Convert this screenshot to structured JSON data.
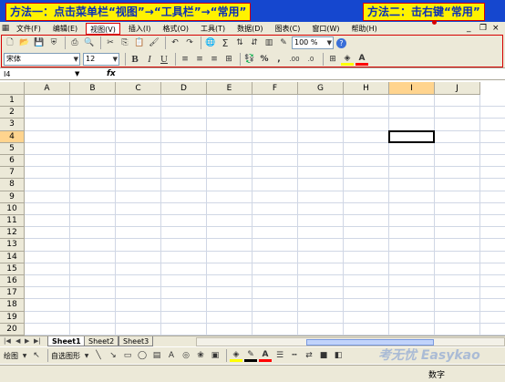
{
  "annotations": {
    "method1": "方法一：点击菜单栏“视图”→“工具栏”→“常用”",
    "method2": "方法二：击右键“常用”"
  },
  "menubar": {
    "items": [
      {
        "label": "文件(F)"
      },
      {
        "label": "编辑(E)"
      },
      {
        "label": "视图(V)"
      },
      {
        "label": "插入(I)"
      },
      {
        "label": "格式(O)"
      },
      {
        "label": "工具(T)"
      },
      {
        "label": "数据(D)"
      },
      {
        "label": "图表(C)"
      },
      {
        "label": "窗口(W)"
      },
      {
        "label": "帮助(H)"
      }
    ],
    "minimize": "_",
    "restore": "❐",
    "close": "×"
  },
  "standard_toolbar": {
    "sum": "Σ",
    "zoom": "100 %",
    "help": "?"
  },
  "format_toolbar": {
    "font": "宋体",
    "size": "12",
    "bold": "B",
    "italic": "I",
    "underline": "U",
    "percent": "%",
    "comma": ",",
    "inc_decimal": ".00",
    "dec_decimal": ".0"
  },
  "formula_bar": {
    "name_box": "I4",
    "fx": "fx"
  },
  "grid": {
    "columns": [
      "A",
      "B",
      "C",
      "D",
      "E",
      "F",
      "G",
      "H",
      "I",
      "J"
    ],
    "rows": [
      "1",
      "2",
      "3",
      "4",
      "5",
      "6",
      "7",
      "8",
      "9",
      "10",
      "11",
      "12",
      "13",
      "14",
      "15",
      "16",
      "17",
      "18",
      "19",
      "20"
    ],
    "selected_cell": "I4"
  },
  "sheets": {
    "tabs": [
      "Sheet1",
      "Sheet2",
      "Sheet3"
    ],
    "active": "Sheet1"
  },
  "drawing_toolbar": {
    "draw": "绘图",
    "autoshapes": "自选图形"
  },
  "statusbar": {
    "mode": "数字"
  },
  "watermark": "考无忧 Easykao",
  "colors": {
    "titlebar": "#1547cf",
    "callout_bg": "#fff200",
    "callout_border": "#d60000",
    "callout_text": "#0a2fb8",
    "chrome": "#ece9d8",
    "selected_header": "#ffd48e"
  }
}
